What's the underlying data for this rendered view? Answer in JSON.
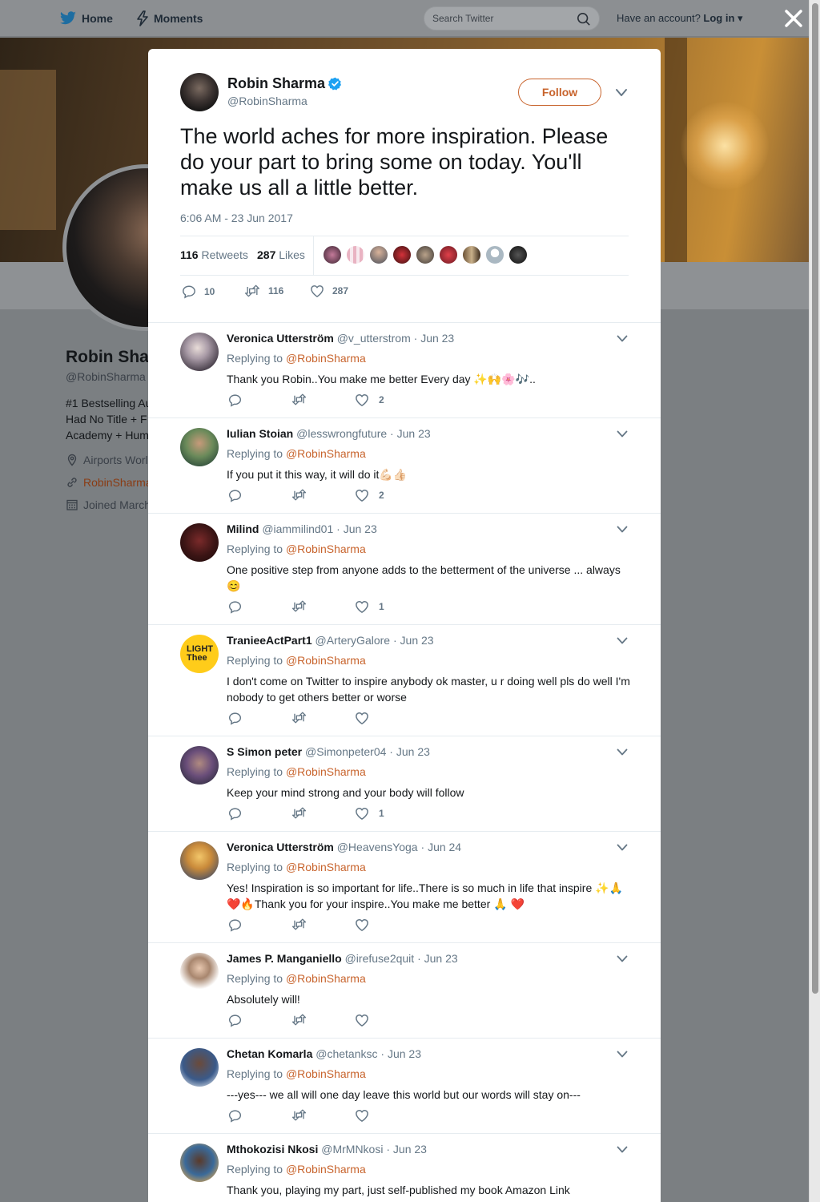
{
  "nav": {
    "home_label": "Home",
    "moments_label": "Moments",
    "search_placeholder": "Search Twitter",
    "account_prompt": "Have an account?",
    "login_label": "Log in"
  },
  "profile_bg": {
    "name": "Robin Sha",
    "handle": "@RobinSharma",
    "bio_lines": [
      "#1 Bestselling Au",
      "Had No Title + F",
      "Academy + Hum"
    ],
    "location": "Airports Worl",
    "website": "RobinSharma",
    "joined": "Joined March"
  },
  "tweet": {
    "author_name": "Robin Sharma",
    "author_handle": "@RobinSharma",
    "follow_label": "Follow",
    "text": "The world aches for more inspiration. Please do your part to bring some on today. You'll make us all a little better.",
    "timestamp": "6:06 AM - 23 Jun 2017",
    "retweets_count": "116",
    "retweets_label": "Retweets",
    "likes_count": "287",
    "likes_label": "Likes",
    "reply_count": "10",
    "retweet_count_action": "116",
    "like_count_action": "287"
  },
  "colors": {
    "accent": "#c8642d",
    "verified": "#1da1f2",
    "muted": "#657786"
  },
  "replying_prefix": "Replying to",
  "replies": [
    {
      "name": "Veronica Utterström",
      "handle": "@v_utterstrom",
      "date": "Jun 23",
      "mention": "@RobinSharma",
      "text": "Thank you Robin..You make me better Every day ✨🙌🌸🎶..",
      "likes": "2"
    },
    {
      "name": "Iulian Stoian",
      "handle": "@lesswrongfuture",
      "date": "Jun 23",
      "mention": "@RobinSharma",
      "text": "If you put it this way, it will do it💪🏻👍🏻",
      "likes": "2"
    },
    {
      "name": "Milind",
      "handle": "@iammilind01",
      "date": "Jun 23",
      "mention": "@RobinSharma",
      "text": "One positive step from anyone adds to the betterment of the universe ... always 😊",
      "likes": "1"
    },
    {
      "name": "TranieeActPart1",
      "handle": "@ArteryGalore",
      "date": "Jun 23",
      "mention": "@RobinSharma",
      "text": "I don't come on Twitter to inspire anybody ok master, u r doing well pls do well I'm nobody to get others better or worse",
      "likes": ""
    },
    {
      "name": "S Simon peter",
      "handle": "@Simonpeter04",
      "date": "Jun 23",
      "mention": "@RobinSharma",
      "text": "Keep your mind strong and your body will follow",
      "likes": "1"
    },
    {
      "name": "Veronica Utterström",
      "handle": "@HeavensYoga",
      "date": "Jun 24",
      "mention": "@RobinSharma",
      "text": "Yes! Inspiration is so important for life..There is so much in life that inspire ✨🙏❤️🔥Thank you for your inspire..You make me better 🙏 ❤️",
      "likes": ""
    },
    {
      "name": "James P. Manganiello",
      "handle": "@irefuse2quit",
      "date": "Jun 23",
      "mention": "@RobinSharma",
      "text": "Absolutely will!",
      "likes": ""
    },
    {
      "name": "Chetan Komarla",
      "handle": "@chetanksc",
      "date": "Jun 23",
      "mention": "@RobinSharma",
      "text": "---yes--- we all will one day leave this world but our words will stay on---",
      "likes": ""
    },
    {
      "name": "Mthokozisi Nkosi",
      "handle": "@MrMNkosi",
      "date": "Jun 23",
      "mention": "@RobinSharma",
      "text": "Thank you, playing my part, just self-published my book Amazon Link",
      "likes": ""
    }
  ],
  "avatar_labels": {
    "traniee": "LIGHT Thee"
  }
}
